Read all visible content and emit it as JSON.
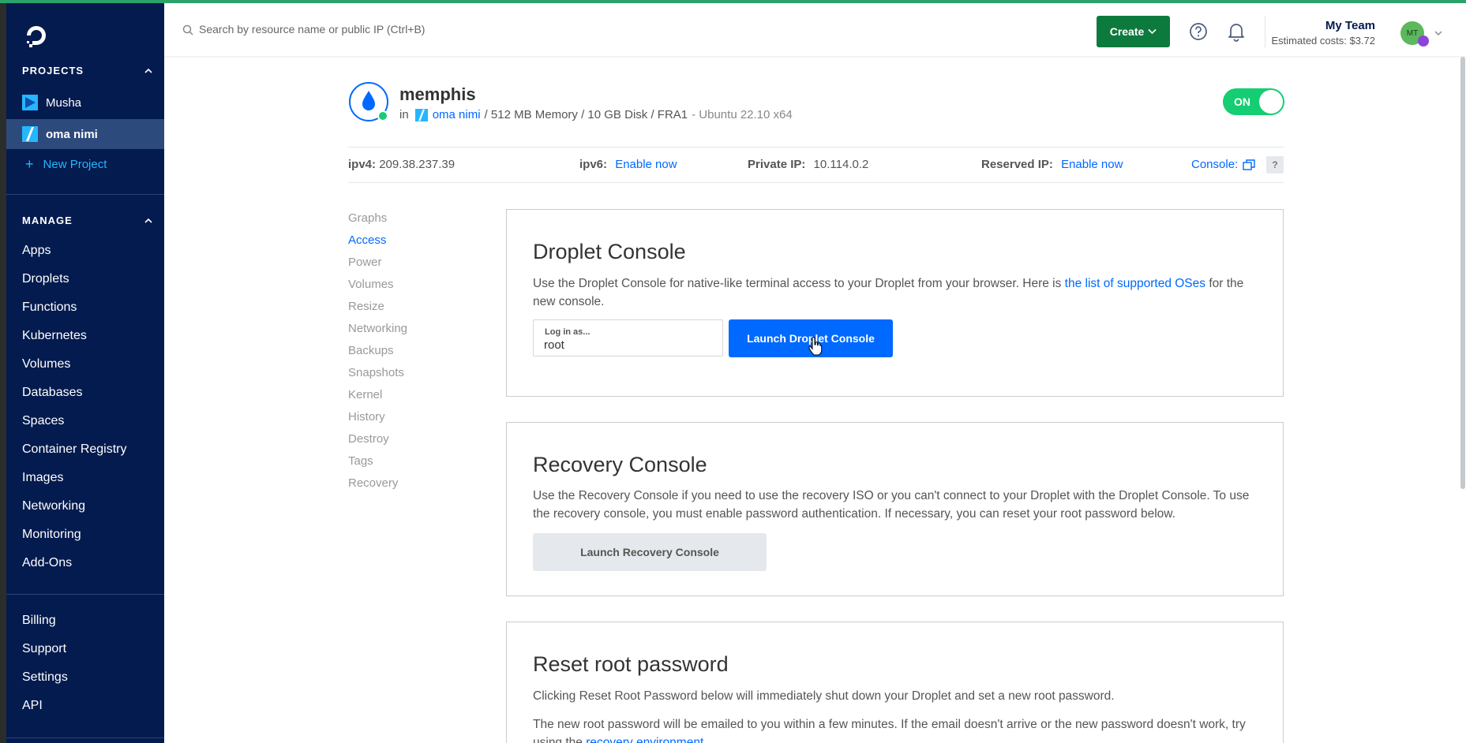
{
  "sidebar": {
    "projects_heading": "PROJECTS",
    "projects": [
      {
        "label": "Musha"
      },
      {
        "label": "oma nimi"
      }
    ],
    "new_project_label": "New Project",
    "manage_heading": "MANAGE",
    "manage_items": [
      {
        "label": "Apps"
      },
      {
        "label": "Droplets"
      },
      {
        "label": "Functions"
      },
      {
        "label": "Kubernetes"
      },
      {
        "label": "Volumes"
      },
      {
        "label": "Databases"
      },
      {
        "label": "Spaces"
      },
      {
        "label": "Container Registry"
      },
      {
        "label": "Images"
      },
      {
        "label": "Networking"
      },
      {
        "label": "Monitoring"
      },
      {
        "label": "Add-Ons"
      }
    ],
    "account_items": [
      {
        "label": "Billing"
      },
      {
        "label": "Support"
      },
      {
        "label": "Settings"
      },
      {
        "label": "API"
      }
    ]
  },
  "header": {
    "search_placeholder": "Search by resource name or public IP (Ctrl+B)",
    "create_label": "Create",
    "team_name": "My Team",
    "estimated_costs": "Estimated costs: $3.72",
    "avatar_initials": "MT"
  },
  "droplet": {
    "name": "memphis",
    "in_prefix": "in",
    "project_link": "oma nimi",
    "specs": "/ 512 MB Memory / 10 GB Disk / FRA1",
    "os": "- Ubuntu 22.10 x64",
    "power_toggle": "ON"
  },
  "ipbar": {
    "ipv4_label": "ipv4:",
    "ipv4_value": "209.38.237.39",
    "ipv6_label": "ipv6:",
    "ipv6_link": "Enable now",
    "private_label": "Private IP:",
    "private_value": "10.114.0.2",
    "reserved_label": "Reserved IP:",
    "reserved_link": "Enable now",
    "console_label": "Console:",
    "help_label": "?"
  },
  "subnav": [
    {
      "label": "Graphs"
    },
    {
      "label": "Access"
    },
    {
      "label": "Power"
    },
    {
      "label": "Volumes"
    },
    {
      "label": "Resize"
    },
    {
      "label": "Networking"
    },
    {
      "label": "Backups"
    },
    {
      "label": "Snapshots"
    },
    {
      "label": "Kernel"
    },
    {
      "label": "History"
    },
    {
      "label": "Destroy"
    },
    {
      "label": "Tags"
    },
    {
      "label": "Recovery"
    }
  ],
  "droplet_console": {
    "title": "Droplet Console",
    "text_before": "Use the Droplet Console for native-like terminal access to your Droplet from your browser. Here is ",
    "text_link": "the list of supported OSes",
    "text_after": " for the new console.",
    "login_label": "Log in as...",
    "login_value": "root",
    "launch_label": "Launch Droplet Console"
  },
  "recovery_console": {
    "title": "Recovery Console",
    "text": "Use the Recovery Console if you need to use the recovery ISO or you can't connect to your Droplet with the Droplet Console. To use the recovery console, you must enable password authentication. If necessary, you can reset your root password below.",
    "launch_label": "Launch Recovery Console"
  },
  "reset_password": {
    "title": "Reset root password",
    "text1": "Clicking Reset Root Password below will immediately shut down your Droplet and set a new root password.",
    "text2_before": "The new root password will be emailed to you within a few minutes. If the email doesn't arrive or the new password doesn't work, try using the ",
    "text2_link": "recovery environment",
    "text2_after": "."
  },
  "colors": {
    "sidebar_bg": "#031b4e",
    "accent_blue": "#0069ff",
    "create_green": "#0d7a3d",
    "toggle_green": "#15cd72"
  }
}
